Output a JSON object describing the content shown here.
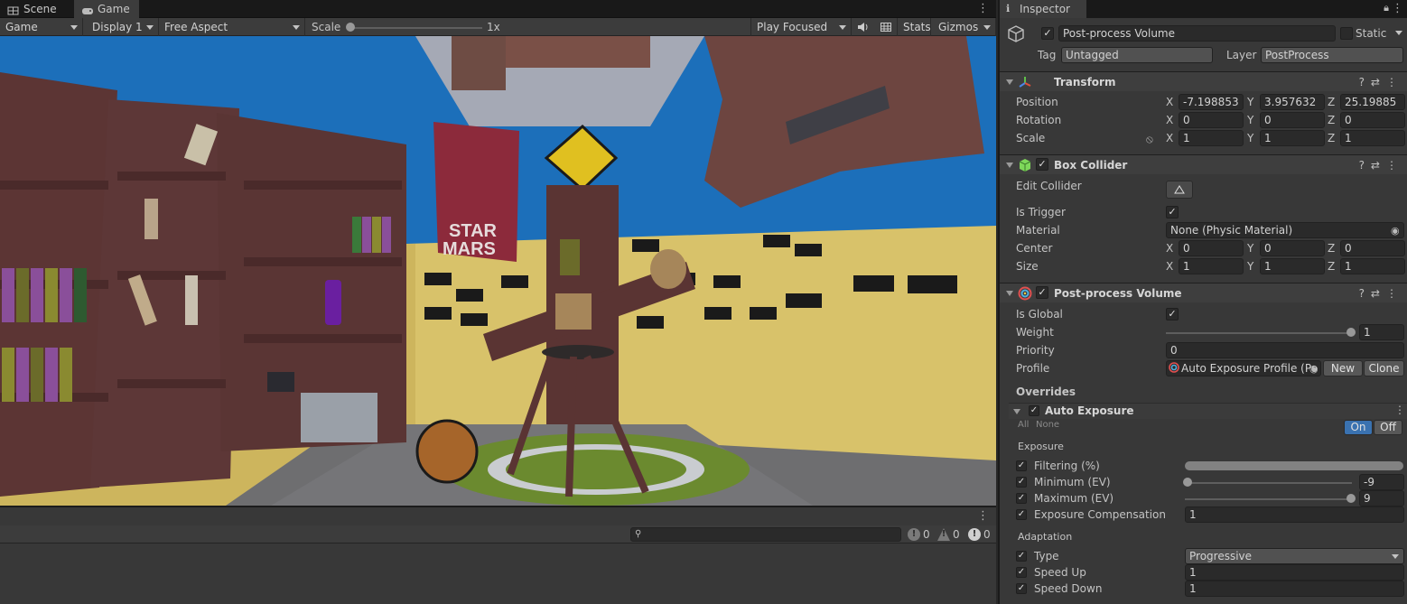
{
  "tabs": {
    "scene": "Scene",
    "game": "Game"
  },
  "game_toolbar": {
    "view": "Game",
    "display": "Display 1",
    "aspect": "Free Aspect",
    "scale_label": "Scale",
    "scale_value": "1x",
    "play_mode": "Play Focused",
    "stats": "Stats",
    "gizmos": "Gizmos"
  },
  "scene": {
    "poster_line1": "STAR",
    "poster_line2": "MARS"
  },
  "console": {
    "search_placeholder": "",
    "log_count": "0",
    "warning_count": "0",
    "error_count": "0"
  },
  "inspector": {
    "tab": "Inspector",
    "object_name": "Post-process Volume",
    "static_label": "Static",
    "tag_label": "Tag",
    "tag_value": "Untagged",
    "layer_label": "Layer",
    "layer_value": "PostProcess",
    "transform": {
      "title": "Transform",
      "position_label": "Position",
      "rotation_label": "Rotation",
      "scale_label": "Scale",
      "position": [
        "-7.198853",
        "3.957632",
        "25.19885"
      ],
      "rotation": [
        "0",
        "0",
        "0"
      ],
      "scale": [
        "1",
        "1",
        "1"
      ]
    },
    "box_collider": {
      "title": "Box Collider",
      "edit_label": "Edit Collider",
      "trigger_label": "Is Trigger",
      "material_label": "Material",
      "material_value": "None (Physic Material)",
      "center_label": "Center",
      "size_label": "Size",
      "center": [
        "0",
        "0",
        "0"
      ],
      "size": [
        "1",
        "1",
        "1"
      ]
    },
    "ppv": {
      "title": "Post-process Volume",
      "global_label": "Is Global",
      "weight_label": "Weight",
      "weight_value": "1",
      "weight_fraction": 1.0,
      "priority_label": "Priority",
      "priority_value": "0",
      "profile_label": "Profile",
      "profile_value": "Auto Exposure Profile (Po",
      "new_btn": "New",
      "clone_btn": "Clone",
      "overrides_label": "Overrides"
    },
    "auto_exposure": {
      "title": "Auto Exposure",
      "all": "All",
      "none": "None",
      "on": "On",
      "off": "Off",
      "exposure_section": "Exposure",
      "filtering_label": "Filtering (%)",
      "min_label": "Minimum (EV)",
      "min_value": "-9",
      "max_label": "Maximum (EV)",
      "max_value": "9",
      "comp_label": "Exposure Compensation",
      "comp_value": "1",
      "adaptation_section": "Adaptation",
      "type_label": "Type",
      "type_value": "Progressive",
      "up_label": "Speed Up",
      "up_value": "1",
      "down_label": "Speed Down",
      "down_value": "1"
    }
  },
  "colors": {
    "accent": "#3a72b0",
    "panel": "#383838",
    "field": "#2a2a2a"
  }
}
